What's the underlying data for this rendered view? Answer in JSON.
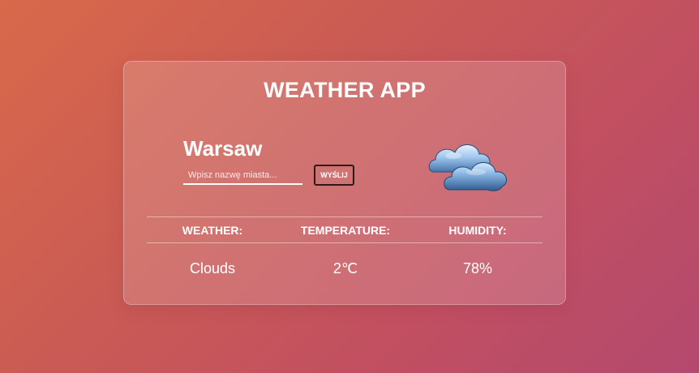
{
  "app": {
    "title": "WEATHER APP"
  },
  "location": {
    "city": "Warsaw"
  },
  "search": {
    "placeholder": "Wpisz nazwę miasta...",
    "value": "",
    "button_label": "WYŚLIJ"
  },
  "current": {
    "icon": "clouds-icon",
    "headers": {
      "weather": "WEATHER:",
      "temperature": "TEMPERATURE:",
      "humidity": "HUMIDITY:"
    },
    "values": {
      "weather": "Clouds",
      "temperature": "2℃",
      "humidity": "78%"
    }
  }
}
